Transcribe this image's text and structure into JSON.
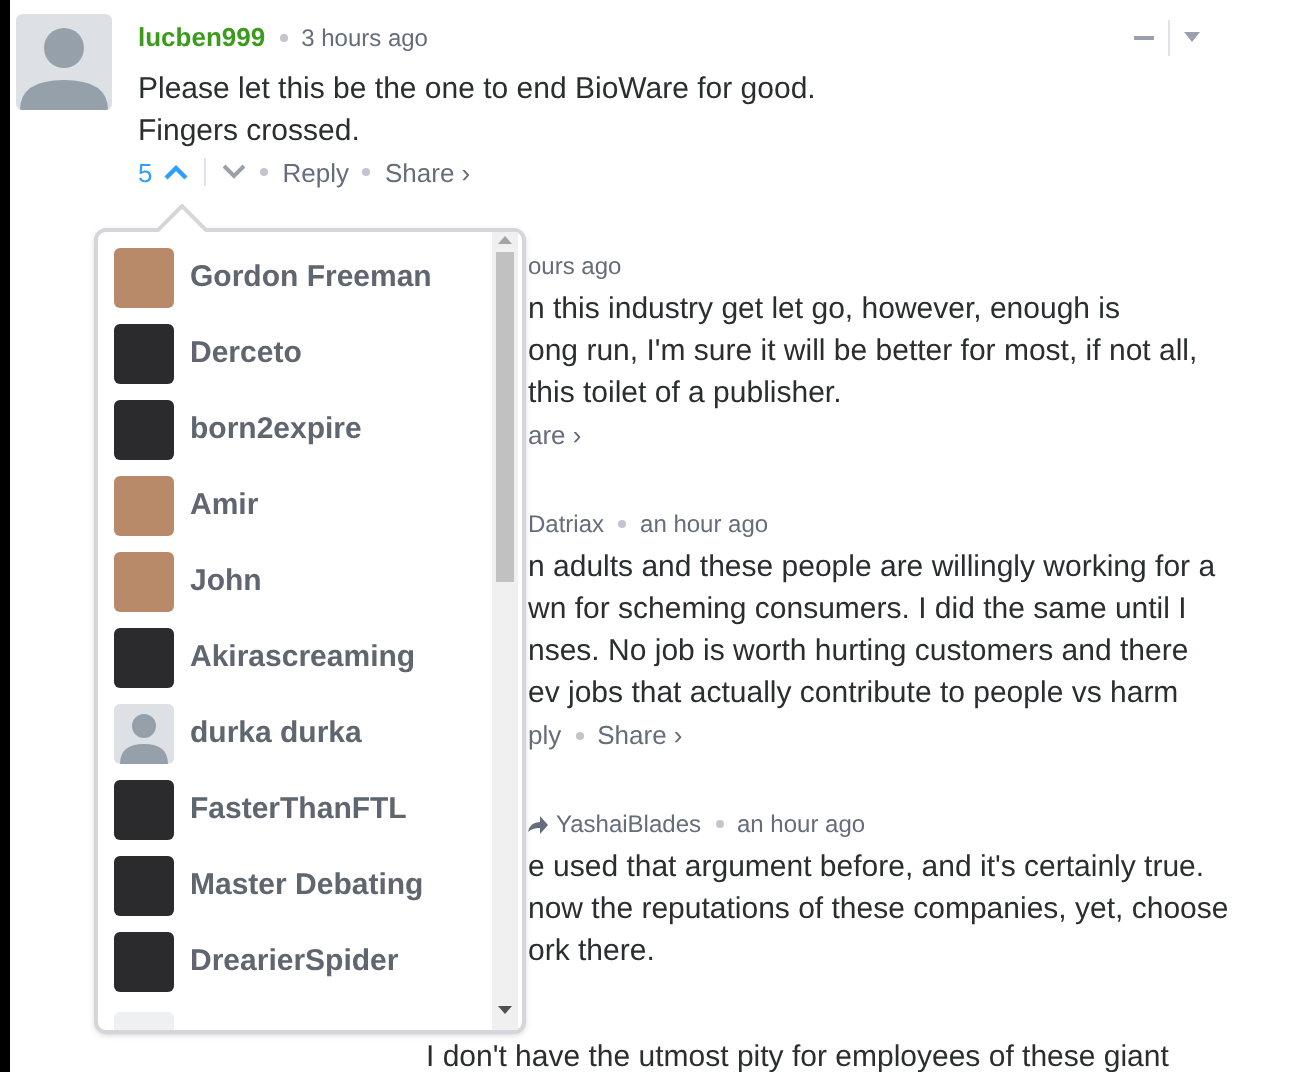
{
  "comment": {
    "author": "lucben999",
    "time": "3 hours ago",
    "lines": [
      "Please let this be the one to end BioWare for good.",
      "Fingers crossed."
    ],
    "votes": "5",
    "upvoted": true,
    "actions": [
      "Reply",
      "Share ›"
    ]
  },
  "voters": [
    {
      "name": "Gordon Freeman",
      "kind": "drawing"
    },
    {
      "name": "Derceto",
      "kind": "photo"
    },
    {
      "name": "born2expire",
      "kind": "photo"
    },
    {
      "name": "Amir",
      "kind": "drawing"
    },
    {
      "name": "John",
      "kind": "drawing"
    },
    {
      "name": "Akirascreaming",
      "kind": "photo"
    },
    {
      "name": "durka durka",
      "kind": "default"
    },
    {
      "name": "FasterThanFTL",
      "kind": "photo"
    },
    {
      "name": "Master Debating",
      "kind": "photo"
    },
    {
      "name": "DrearierSpider",
      "kind": "photo"
    }
  ],
  "behind": [
    {
      "kind": "meta",
      "time": "ours ago"
    },
    {
      "kind": "text",
      "text": "n this industry get let go, however, enough is"
    },
    {
      "kind": "text",
      "text": "ong run, I'm sure it will be better for most, if not all,"
    },
    {
      "kind": "text",
      "text": "this toilet of a publisher."
    },
    {
      "kind": "actions",
      "actions": [
        "are ›"
      ]
    },
    {
      "kind": "meta",
      "author": "Datriax",
      "time": "an hour ago"
    },
    {
      "kind": "text",
      "text": "n adults and these people are willingly working for a"
    },
    {
      "kind": "text",
      "text": "wn for scheming consumers. I did the same until I"
    },
    {
      "kind": "text",
      "text": "nses. No job is worth hurting customers and there"
    },
    {
      "kind": "text",
      "text": "ev jobs that actually contribute to people vs harm"
    },
    {
      "kind": "actions",
      "actions": [
        "ply",
        "Share ›"
      ]
    },
    {
      "kind": "meta",
      "author": "YashaiBlades",
      "time": "an hour ago",
      "arrow": true
    },
    {
      "kind": "text",
      "text": "e used that argument before, and it's certainly true."
    },
    {
      "kind": "text",
      "text": "now the reputations of these companies, yet, choose"
    },
    {
      "kind": "text",
      "text": "ork there."
    }
  ],
  "last_line": "I don't have the utmost pity for employees of these giant"
}
